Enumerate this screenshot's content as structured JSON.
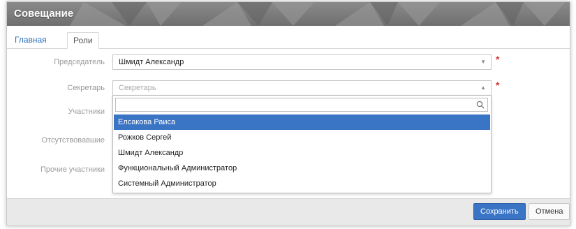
{
  "window": {
    "title": "Совещание"
  },
  "tabs": [
    {
      "label": "Главная",
      "active": false
    },
    {
      "label": "Роли",
      "active": true
    }
  ],
  "form": {
    "chairman": {
      "label": "Председатель",
      "value": "Шмидт Александр",
      "required": "*"
    },
    "secretary": {
      "label": "Секретарь",
      "placeholder": "Секретарь",
      "required": "*",
      "open": true
    },
    "participants": {
      "label": "Участники"
    },
    "absent": {
      "label": "Отсутствовавшие"
    },
    "others": {
      "label": "Прочие участники"
    }
  },
  "dropdown": {
    "search_value": "",
    "options": [
      "Елсакова Раиса",
      "Рожков Сергей",
      "Шмидт Александр",
      "Функциональный Администратор",
      "Системный Администратор"
    ],
    "selected_index": 0
  },
  "footer": {
    "save_label": "Сохранить",
    "cancel_label": "Отмена"
  },
  "colors": {
    "accent": "#3a74c5",
    "required": "#d43a3a",
    "titlebar": "#7a7a7a"
  }
}
